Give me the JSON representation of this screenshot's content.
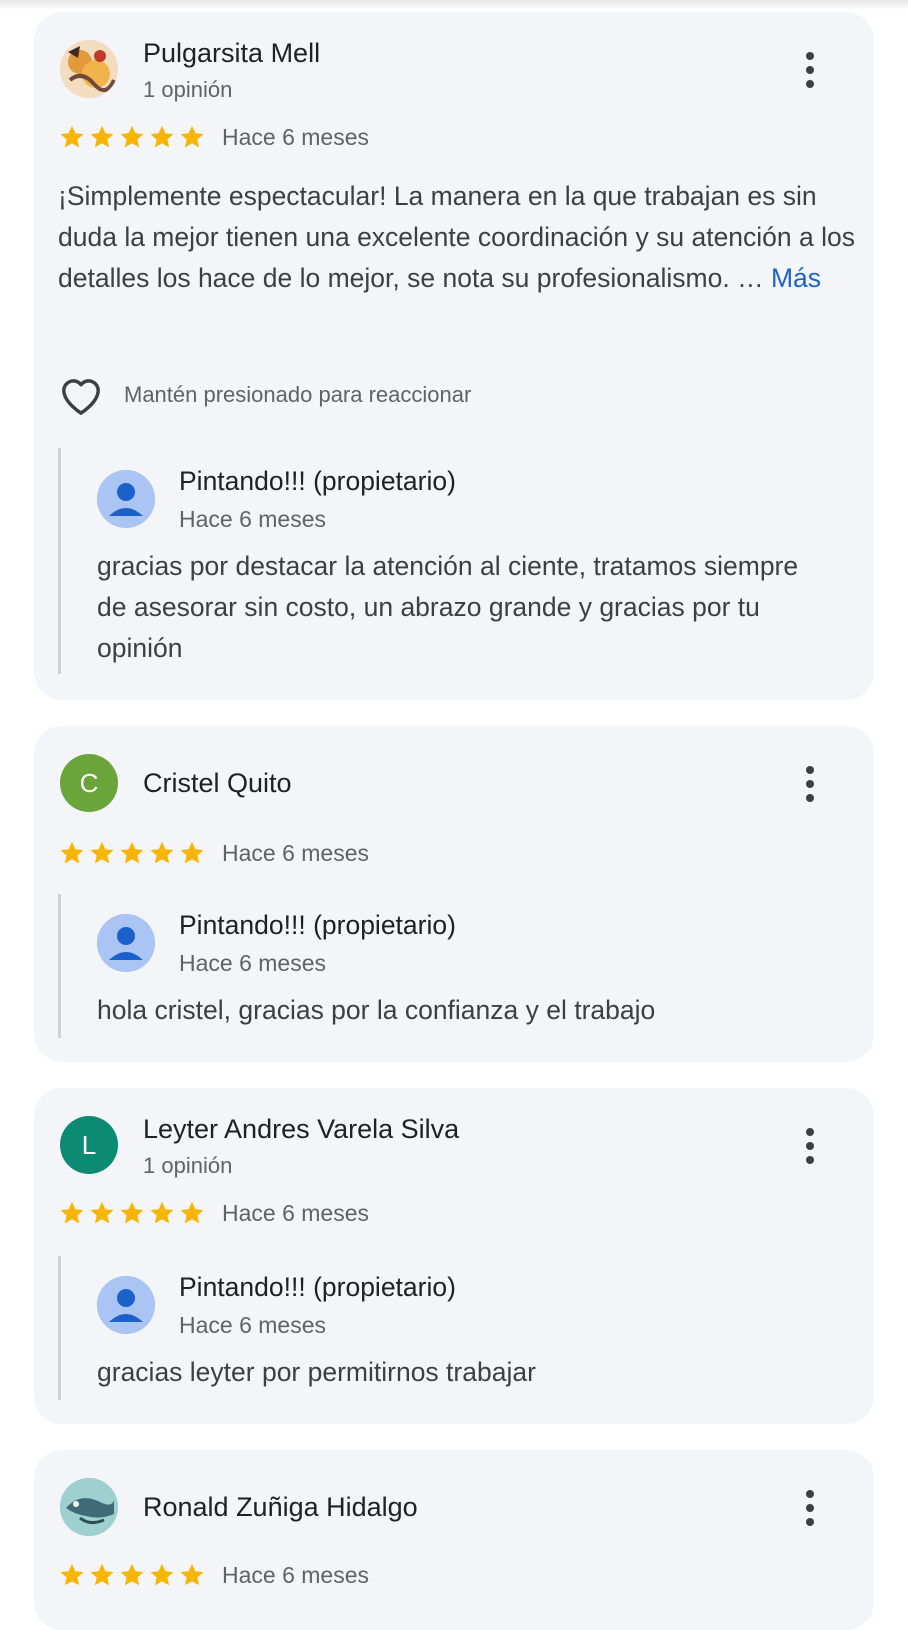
{
  "colors": {
    "star": "#f8b500",
    "link": "#1a62c9",
    "card_bg": "#f3f5f8"
  },
  "reviews": [
    {
      "author": "Pulgarsita Mell",
      "subtitle": "1 opinión",
      "avatar_type": "photo",
      "rating": 5,
      "date": "Hace 6 meses",
      "text": "¡Simplemente espectacular! La manera en la que trabajan es sin duda la mejor tienen una excelente coordinación y su atención a los detalles los hace de lo mejor, se nota su profesionalismo. …",
      "more_link": "Más",
      "reaction_hint": "Mantén presionado para reaccionar",
      "reply": {
        "author": "Pintando!!! (propietario)",
        "date": "Hace 6 meses",
        "text": "gracias por destacar la atención al ciente, tratamos siempre de asesorar sin costo, un abrazo grande y gracias por tu opinión"
      }
    },
    {
      "author": "Cristel Quito",
      "avatar_letter": "C",
      "avatar_color": "#6aa43a",
      "rating": 5,
      "date": "Hace 6 meses",
      "reply": {
        "author": "Pintando!!! (propietario)",
        "date": "Hace 6 meses",
        "text": "hola cristel, gracias por la confianza y el trabajo"
      }
    },
    {
      "author": "Leyter Andres Varela Silva",
      "subtitle": "1 opinión",
      "avatar_letter": "L",
      "avatar_color": "#0d8a74",
      "rating": 5,
      "date": "Hace 6 meses",
      "reply": {
        "author": "Pintando!!! (propietario)",
        "date": "Hace 6 meses",
        "text": "gracias leyter por permitirnos trabajar"
      }
    },
    {
      "author": "Ronald Zuñiga Hidalgo",
      "avatar_type": "photo",
      "rating": 5,
      "date": "Hace 6 meses"
    }
  ],
  "icons": {
    "more": "more-vert-icon",
    "star": "star-icon",
    "heart": "heart-outline-icon",
    "owner_avatar": "person-icon"
  }
}
